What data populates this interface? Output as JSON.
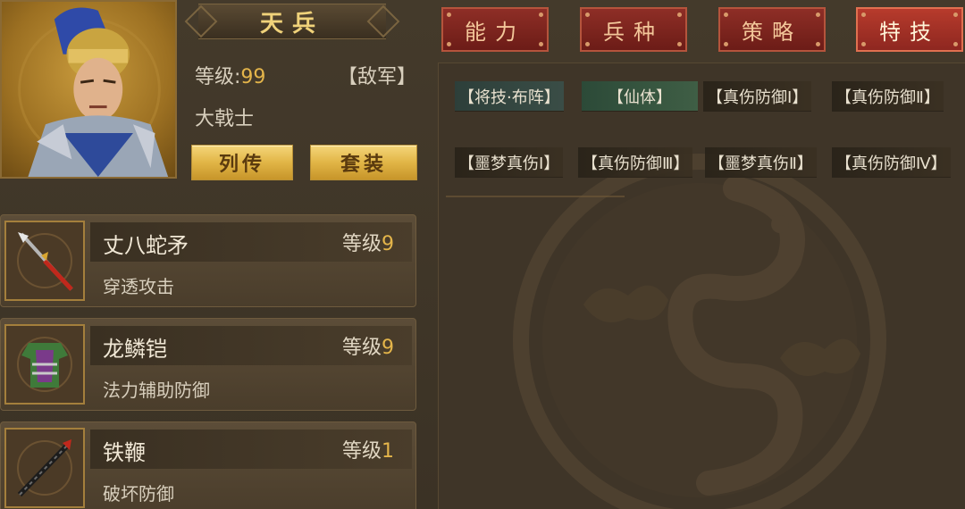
{
  "hero": {
    "title": "天兵",
    "level_label": "等级:",
    "level_value": "99",
    "faction": "【敌军】",
    "class": "大戟士",
    "bio_button": "列传",
    "set_button": "套装"
  },
  "equipment": [
    {
      "name": "丈八蛇矛",
      "level_label": "等级",
      "level": "9",
      "desc": "穿透攻击",
      "icon": "spear-icon"
    },
    {
      "name": "龙鳞铠",
      "level_label": "等级",
      "level": "9",
      "desc": "法力辅助防御",
      "icon": "armor-icon"
    },
    {
      "name": "铁鞭",
      "level_label": "等级",
      "level": "1",
      "desc": "破坏防御",
      "icon": "whip-icon"
    }
  ],
  "tabs": [
    {
      "label": "能力",
      "active": false
    },
    {
      "label": "兵种",
      "active": false
    },
    {
      "label": "策略",
      "active": false
    },
    {
      "label": "特技",
      "active": true
    }
  ],
  "skills_row1": [
    "【将技·布阵】",
    "【仙体】",
    "【真伤防御Ⅰ】",
    "【真伤防御Ⅱ】"
  ],
  "skills_row2": [
    "【噩梦真伤Ⅰ】",
    "【真伤防御Ⅲ】",
    "【噩梦真伤Ⅱ】",
    "【真伤防御Ⅳ】"
  ],
  "colors": {
    "accent_gold": "#e4b54a",
    "tab_red": "#8e2e26",
    "tab_active": "#b73b2c",
    "background": "#3f3528"
  }
}
